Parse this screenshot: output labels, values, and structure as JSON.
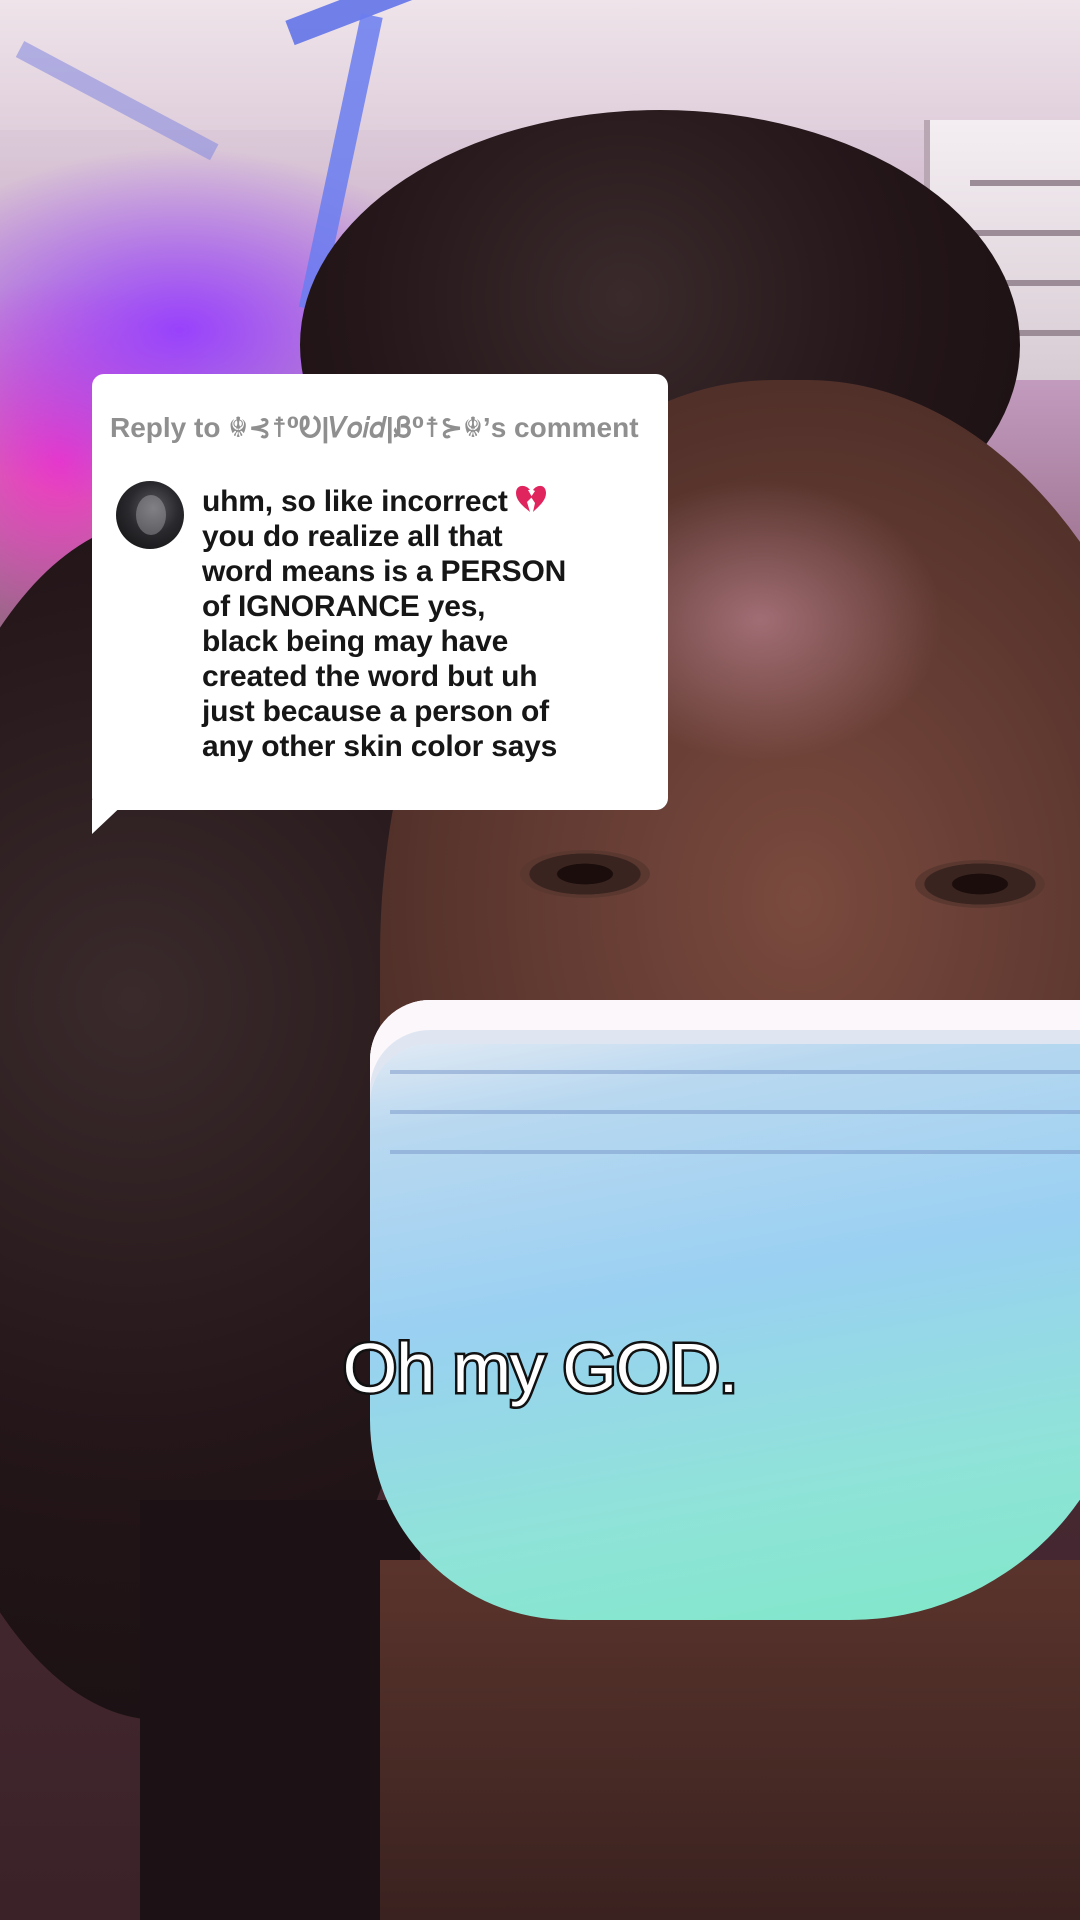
{
  "reply": {
    "header": "Reply to ☬⊰☨⁰Ꭷ|𝑉𝑜𝑖𝑑|Ᏸ⁰☨⊱☬’s comment",
    "commenter_avatar": "avatar",
    "comment_lines": [
      "uhm, so like incorrect",
      "you do realize all that",
      "word means is a PERSON",
      "of IGNORANCE yes,",
      "black being may have",
      "created the word but uh",
      "just because a person of",
      "any other skin color says"
    ],
    "emoji_icon": "broken-heart-icon",
    "emoji_color": "#e0245e"
  },
  "caption": {
    "text": "Oh my GOD."
  }
}
